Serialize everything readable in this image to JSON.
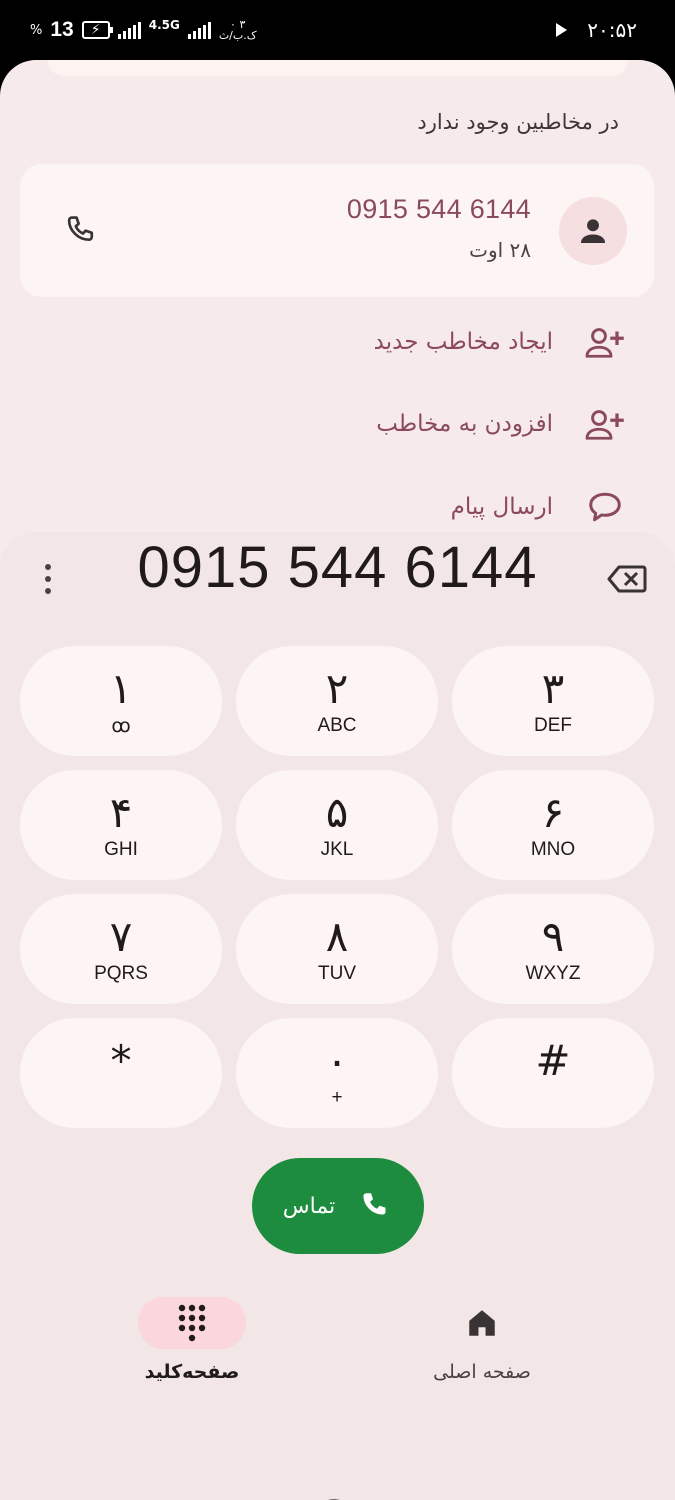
{
  "status_bar": {
    "battery_percent": "13",
    "percent_sign": "%",
    "network": "4.5G",
    "speed_value": "۰ ۳",
    "speed_unit": "ک.ب/ث",
    "time": "۲۰:۵۲"
  },
  "suggestion": {
    "not_in_contacts": "در مخاطبین وجود ندارد"
  },
  "recent_card": {
    "number": "0915 544 6144",
    "date": "۲۸ اوت"
  },
  "actions": [
    {
      "label": "ایجاد مخاطب جدید",
      "icon": "add-person-icon"
    },
    {
      "label": "افزودن به مخاطب",
      "icon": "add-person-icon"
    },
    {
      "label": "ارسال پیام",
      "icon": "message-icon"
    }
  ],
  "dialpad": {
    "dialed_number": "0915 544 6144",
    "keys": [
      {
        "digit": "۱",
        "letters": "ꝏ"
      },
      {
        "digit": "۲",
        "letters": "ABC"
      },
      {
        "digit": "۳",
        "letters": "DEF"
      },
      {
        "digit": "۴",
        "letters": "GHI"
      },
      {
        "digit": "۵",
        "letters": "JKL"
      },
      {
        "digit": "۶",
        "letters": "MNO"
      },
      {
        "digit": "۷",
        "letters": "PQRS"
      },
      {
        "digit": "۸",
        "letters": "TUV"
      },
      {
        "digit": "۹",
        "letters": "WXYZ"
      },
      {
        "digit": "*",
        "letters": ""
      },
      {
        "digit": "۰",
        "letters": "+"
      },
      {
        "digit": "#",
        "letters": ""
      }
    ],
    "call_label": "تماس"
  },
  "bottom_nav": {
    "keypad_label": "صفحه‌کلید",
    "home_label": "صفحه اصلی"
  },
  "colors": {
    "accent": "#8b4a5c",
    "call_green": "#1e8c3e",
    "sheet_bg": "#f7eaea",
    "key_bg": "#fdf5f3",
    "selected_nav_pill": "#fbd6dc"
  }
}
